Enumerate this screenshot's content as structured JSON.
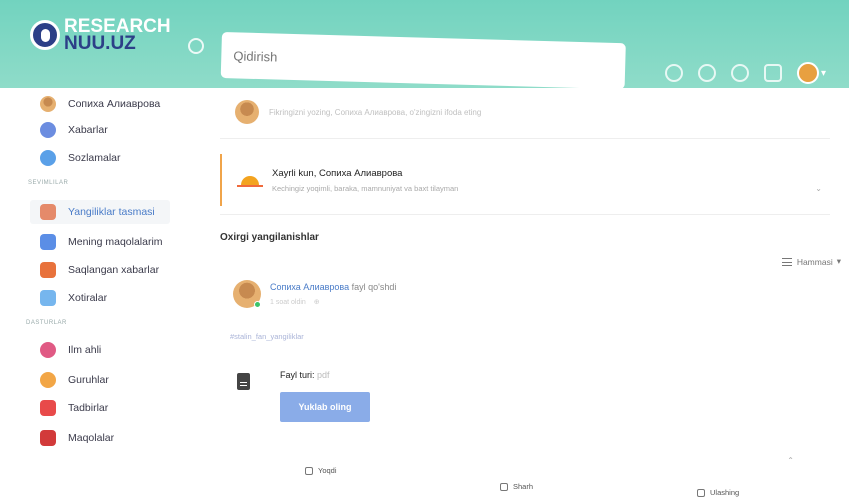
{
  "header": {
    "logo": {
      "line1": "RESEARCH",
      "line2": "NUU.UZ"
    },
    "search": {
      "value": "",
      "placeholder": "Qidirish"
    },
    "colors": {
      "header_bg": "#72d3bf",
      "logo_dark": "#2c3f87"
    },
    "icons": [
      "home-icon",
      "plus-circle-icon",
      "users-icon",
      "chat-icon",
      "bell-icon"
    ]
  },
  "sidebar": {
    "profile": {
      "name": "Сопиха Алиаврова",
      "icon": "avatar"
    },
    "items": [
      {
        "label": "Xabarlar",
        "icon": "messages-icon",
        "color": "#6c8de0"
      },
      {
        "label": "Sozlamalar",
        "icon": "settings-icon",
        "color": "#5aa0e8"
      }
    ],
    "section1": "SEVIMLILAR",
    "favorites": [
      {
        "label": "Yangiliklar tasmasi",
        "icon": "news-feed-icon",
        "color": "#e58a6a",
        "active": true
      },
      {
        "label": "Mening maqolalarim",
        "icon": "my-articles-icon",
        "color": "#5b8ee6"
      },
      {
        "label": "Saqlangan xabarlar",
        "icon": "saved-messages-icon",
        "color": "#e8723c"
      },
      {
        "label": "Xotiralar",
        "icon": "memories-icon",
        "color": "#76b6ee"
      }
    ],
    "section2": "DASTURLAR",
    "programs": [
      {
        "label": "Ilm ahli",
        "icon": "scholars-icon",
        "color": "#e05a84"
      },
      {
        "label": "Guruhlar",
        "icon": "groups-icon",
        "color": "#f2a646"
      },
      {
        "label": "Tadbirlar",
        "icon": "events-icon",
        "color": "#e84a4a"
      },
      {
        "label": "Maqolalar",
        "icon": "articles-icon",
        "color": "#d23a3a"
      }
    ]
  },
  "composer": {
    "placeholder": "Fikringizni yozing, Сопиха Алиаврова, o'zingizni ifoda eting"
  },
  "welcome": {
    "title": "Xayrli kun, Сопиха Алиаврова",
    "subtitle": "Kechingiz yoqimli, baraka, mamnuniyat va baxt tilayman"
  },
  "feed": {
    "title": "Oxirgi yangilanishlar",
    "filter": "Hammasi",
    "post": {
      "author": "Сопиха Алиаврова",
      "action": "fayl qo'shdi",
      "time": "1 soat oldin",
      "hashtag": "#stalin_fan_yangiliklar",
      "file_label": "Fayl turi:",
      "file_ext": "pdf",
      "download": "Yuklab oling"
    },
    "actions": {
      "like": "Yoqdi",
      "comment": "Sharh",
      "share": "Ulashing"
    }
  }
}
